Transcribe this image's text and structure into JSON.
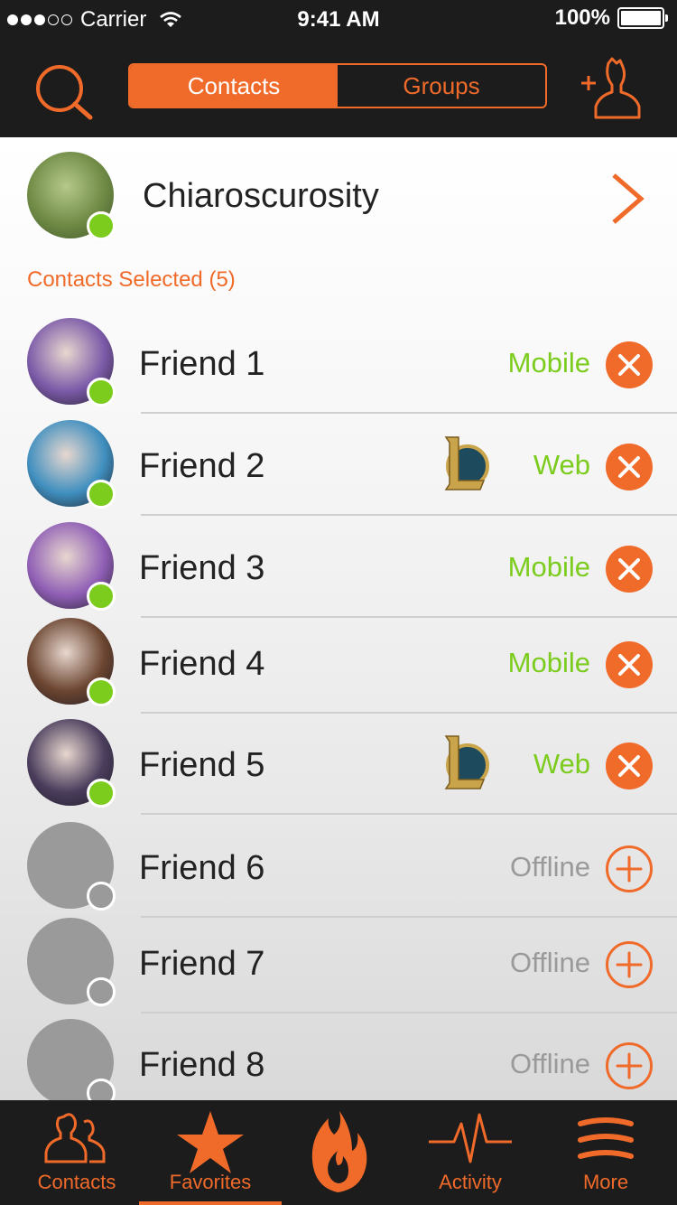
{
  "status": {
    "carrier": "Carrier",
    "time": "9:41 AM",
    "battery": "100%"
  },
  "header": {
    "segments": [
      {
        "label": "Contacts",
        "active": true
      },
      {
        "label": "Groups",
        "active": false
      }
    ]
  },
  "me": {
    "name": "Chiaroscurosity",
    "online": true
  },
  "section_title": "Contacts Selected (5)",
  "friends": [
    {
      "name": "Friend 1",
      "status": "Mobile",
      "online": true,
      "selected": true,
      "lol": false,
      "color": "#7b5aa8"
    },
    {
      "name": "Friend 2",
      "status": "Web",
      "online": true,
      "selected": true,
      "lol": true,
      "color": "#3f8fbf"
    },
    {
      "name": "Friend 3",
      "status": "Mobile",
      "online": true,
      "selected": true,
      "lol": false,
      "color": "#8f5eb5"
    },
    {
      "name": "Friend 4",
      "status": "Mobile",
      "online": true,
      "selected": true,
      "lol": false,
      "color": "#6b4530"
    },
    {
      "name": "Friend 5",
      "status": "Web",
      "online": true,
      "selected": true,
      "lol": true,
      "color": "#4a3d5c"
    },
    {
      "name": "Friend 6",
      "status": "Offline",
      "online": false,
      "selected": false,
      "lol": false,
      "color": "#9a9a9a"
    },
    {
      "name": "Friend 7",
      "status": "Offline",
      "online": false,
      "selected": false,
      "lol": false,
      "color": "#9a9a9a"
    },
    {
      "name": "Friend 8",
      "status": "Offline",
      "online": false,
      "selected": false,
      "lol": false,
      "color": "#9a9a9a"
    }
  ],
  "tabs": [
    {
      "label": "Contacts",
      "icon": "contacts-icon",
      "active": false
    },
    {
      "label": "Favorites",
      "icon": "star-icon",
      "active": true
    },
    {
      "label": "",
      "icon": "flame-icon",
      "active": false
    },
    {
      "label": "Activity",
      "icon": "activity-icon",
      "active": false
    },
    {
      "label": "More",
      "icon": "menu-icon",
      "active": false
    }
  ],
  "colors": {
    "accent": "#f06a2a",
    "online": "#7ccc1e",
    "offline": "#9a9a9a",
    "bar": "#1c1c1c"
  }
}
